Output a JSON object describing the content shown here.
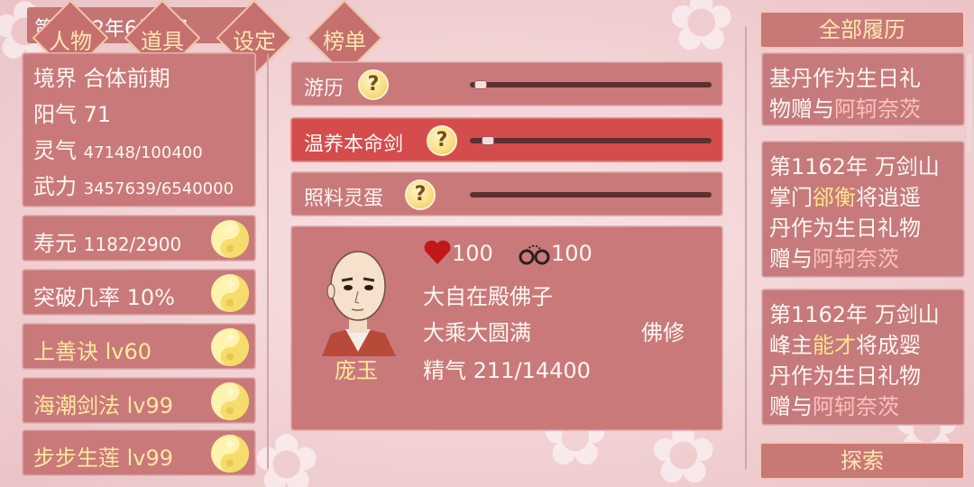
{
  "header": {
    "date": "第1162年6月6日",
    "nav": [
      {
        "label": "人物"
      },
      {
        "label": "道具"
      },
      {
        "label": "设定"
      },
      {
        "label": "榜单"
      }
    ]
  },
  "stats": {
    "realm_label": "境界",
    "realm_value": "合体前期",
    "yang_label": "阳气",
    "yang_value": "71",
    "ling_label": "灵气",
    "ling_value": "47148/100400",
    "wuli_label": "武力",
    "wuli_value": "3457639/6540000"
  },
  "skills": [
    {
      "label": "寿元",
      "value": "1182/2900",
      "style": "white"
    },
    {
      "label": "突破几率",
      "value": "10%",
      "style": "white"
    },
    {
      "label": "上善诀",
      "value": "lv60",
      "style": "gold"
    },
    {
      "label": "海潮剑法",
      "value": "lv99",
      "style": "gold"
    },
    {
      "label": "步步生莲",
      "value": "lv99",
      "style": "gold"
    }
  ],
  "actions": [
    {
      "label": "游历",
      "progress": 0.02
    },
    {
      "label": "温养本命剑",
      "progress": 0.05
    },
    {
      "label": "照料灵蛋",
      "progress": 0.0
    }
  ],
  "character": {
    "name": "庞玉",
    "hp": "100",
    "bond": "100",
    "title": "大自在殿佛子",
    "stage": "大乘大圆满",
    "path": "佛修",
    "essence_label": "精气",
    "essence_value": "211/14400"
  },
  "right": {
    "history_button": "全部履历",
    "explore_button": "探索",
    "logs": [
      {
        "lines": [
          [
            "基丹作为生日礼"
          ],
          [
            "物赠与",
            "阿轲奈茨"
          ]
        ]
      },
      {
        "lines": [
          [
            "第1162年 万剑山"
          ],
          [
            "掌门",
            "郤衡",
            "将逍遥"
          ],
          [
            "丹作为生日礼物"
          ],
          [
            "赠与",
            "阿轲奈茨"
          ]
        ]
      },
      {
        "lines": [
          [
            "第1162年 万剑山"
          ],
          [
            "峰主",
            "能才",
            "将成婴"
          ],
          [
            "丹作为生日礼物"
          ],
          [
            "赠与",
            "阿轲奈茨"
          ]
        ]
      }
    ]
  },
  "colors": {
    "panel": "#c9797a",
    "active_action": "#d44c4b",
    "gold_text": "#ffe7a0",
    "highlight_name": "#ffe38a",
    "recipient_name": "#ffc0c0"
  }
}
